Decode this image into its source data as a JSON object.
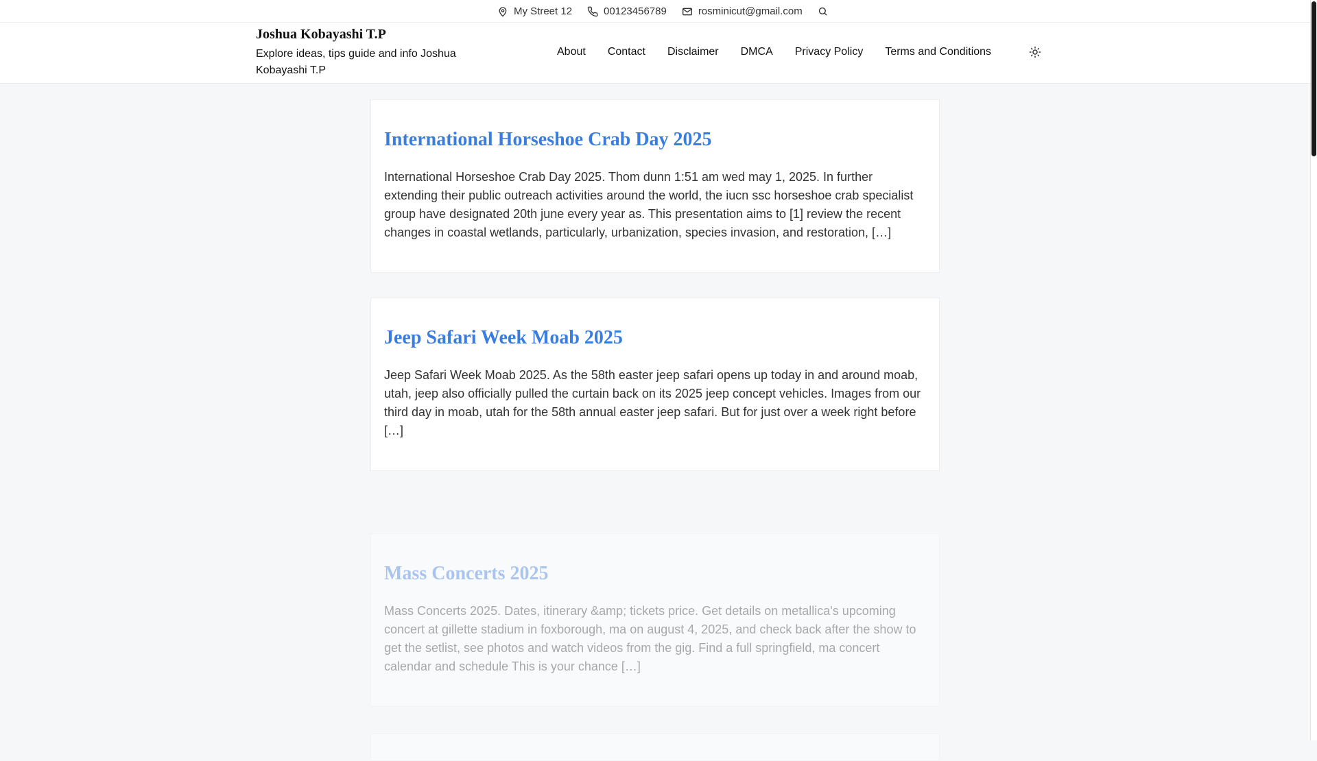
{
  "topbar": {
    "address": "My Street 12",
    "phone": "00123456789",
    "email": "rosminicut@gmail.com"
  },
  "header": {
    "site_title": "Joshua Kobayashi T.P",
    "tagline": "Explore ideas, tips guide and info Joshua Kobayashi T.P",
    "nav": [
      "About",
      "Contact",
      "Disclaimer",
      "DMCA",
      "Privacy Policy",
      "Terms and Conditions"
    ]
  },
  "posts": [
    {
      "title": "International Horseshoe Crab Day 2025",
      "excerpt": "International Horseshoe Crab Day 2025. Thom dunn 1:51 am wed may 1, 2025. In further extending their public outreach activities around the world, the iucn ssc horseshoe crab specialist group have designated 20th june every year as. This presentation aims to [1] review the recent changes in coastal wetlands, particularly, urbanization, species invasion, and restoration, […]"
    },
    {
      "title": "Jeep Safari Week Moab 2025",
      "excerpt": "Jeep Safari Week Moab 2025. As the 58th easter jeep safari opens up today in and around moab, utah, jeep also officially pulled the curtain back on its 2025 jeep concept vehicles. Images from our third day in moab, utah for the 58th annual easter jeep safari. But for just over a week right before […]"
    },
    {
      "title": "Mass Concerts 2025",
      "excerpt": "Mass Concerts 2025. Dates, itinerary &amp; tickets price. Get details on metallica's upcoming concert at gillette stadium in foxborough, ma on august 4, 2025, and check back after the show to get the setlist, see photos and watch videos from the gig. Find a full springfield, ma concert calendar and schedule This is your chance […]"
    }
  ],
  "colors": {
    "accent": "#3b7ddd",
    "background": "#f6f7f9"
  },
  "icons": [
    "map-pin-icon",
    "phone-icon",
    "mail-icon",
    "search-icon",
    "sun-icon"
  ]
}
